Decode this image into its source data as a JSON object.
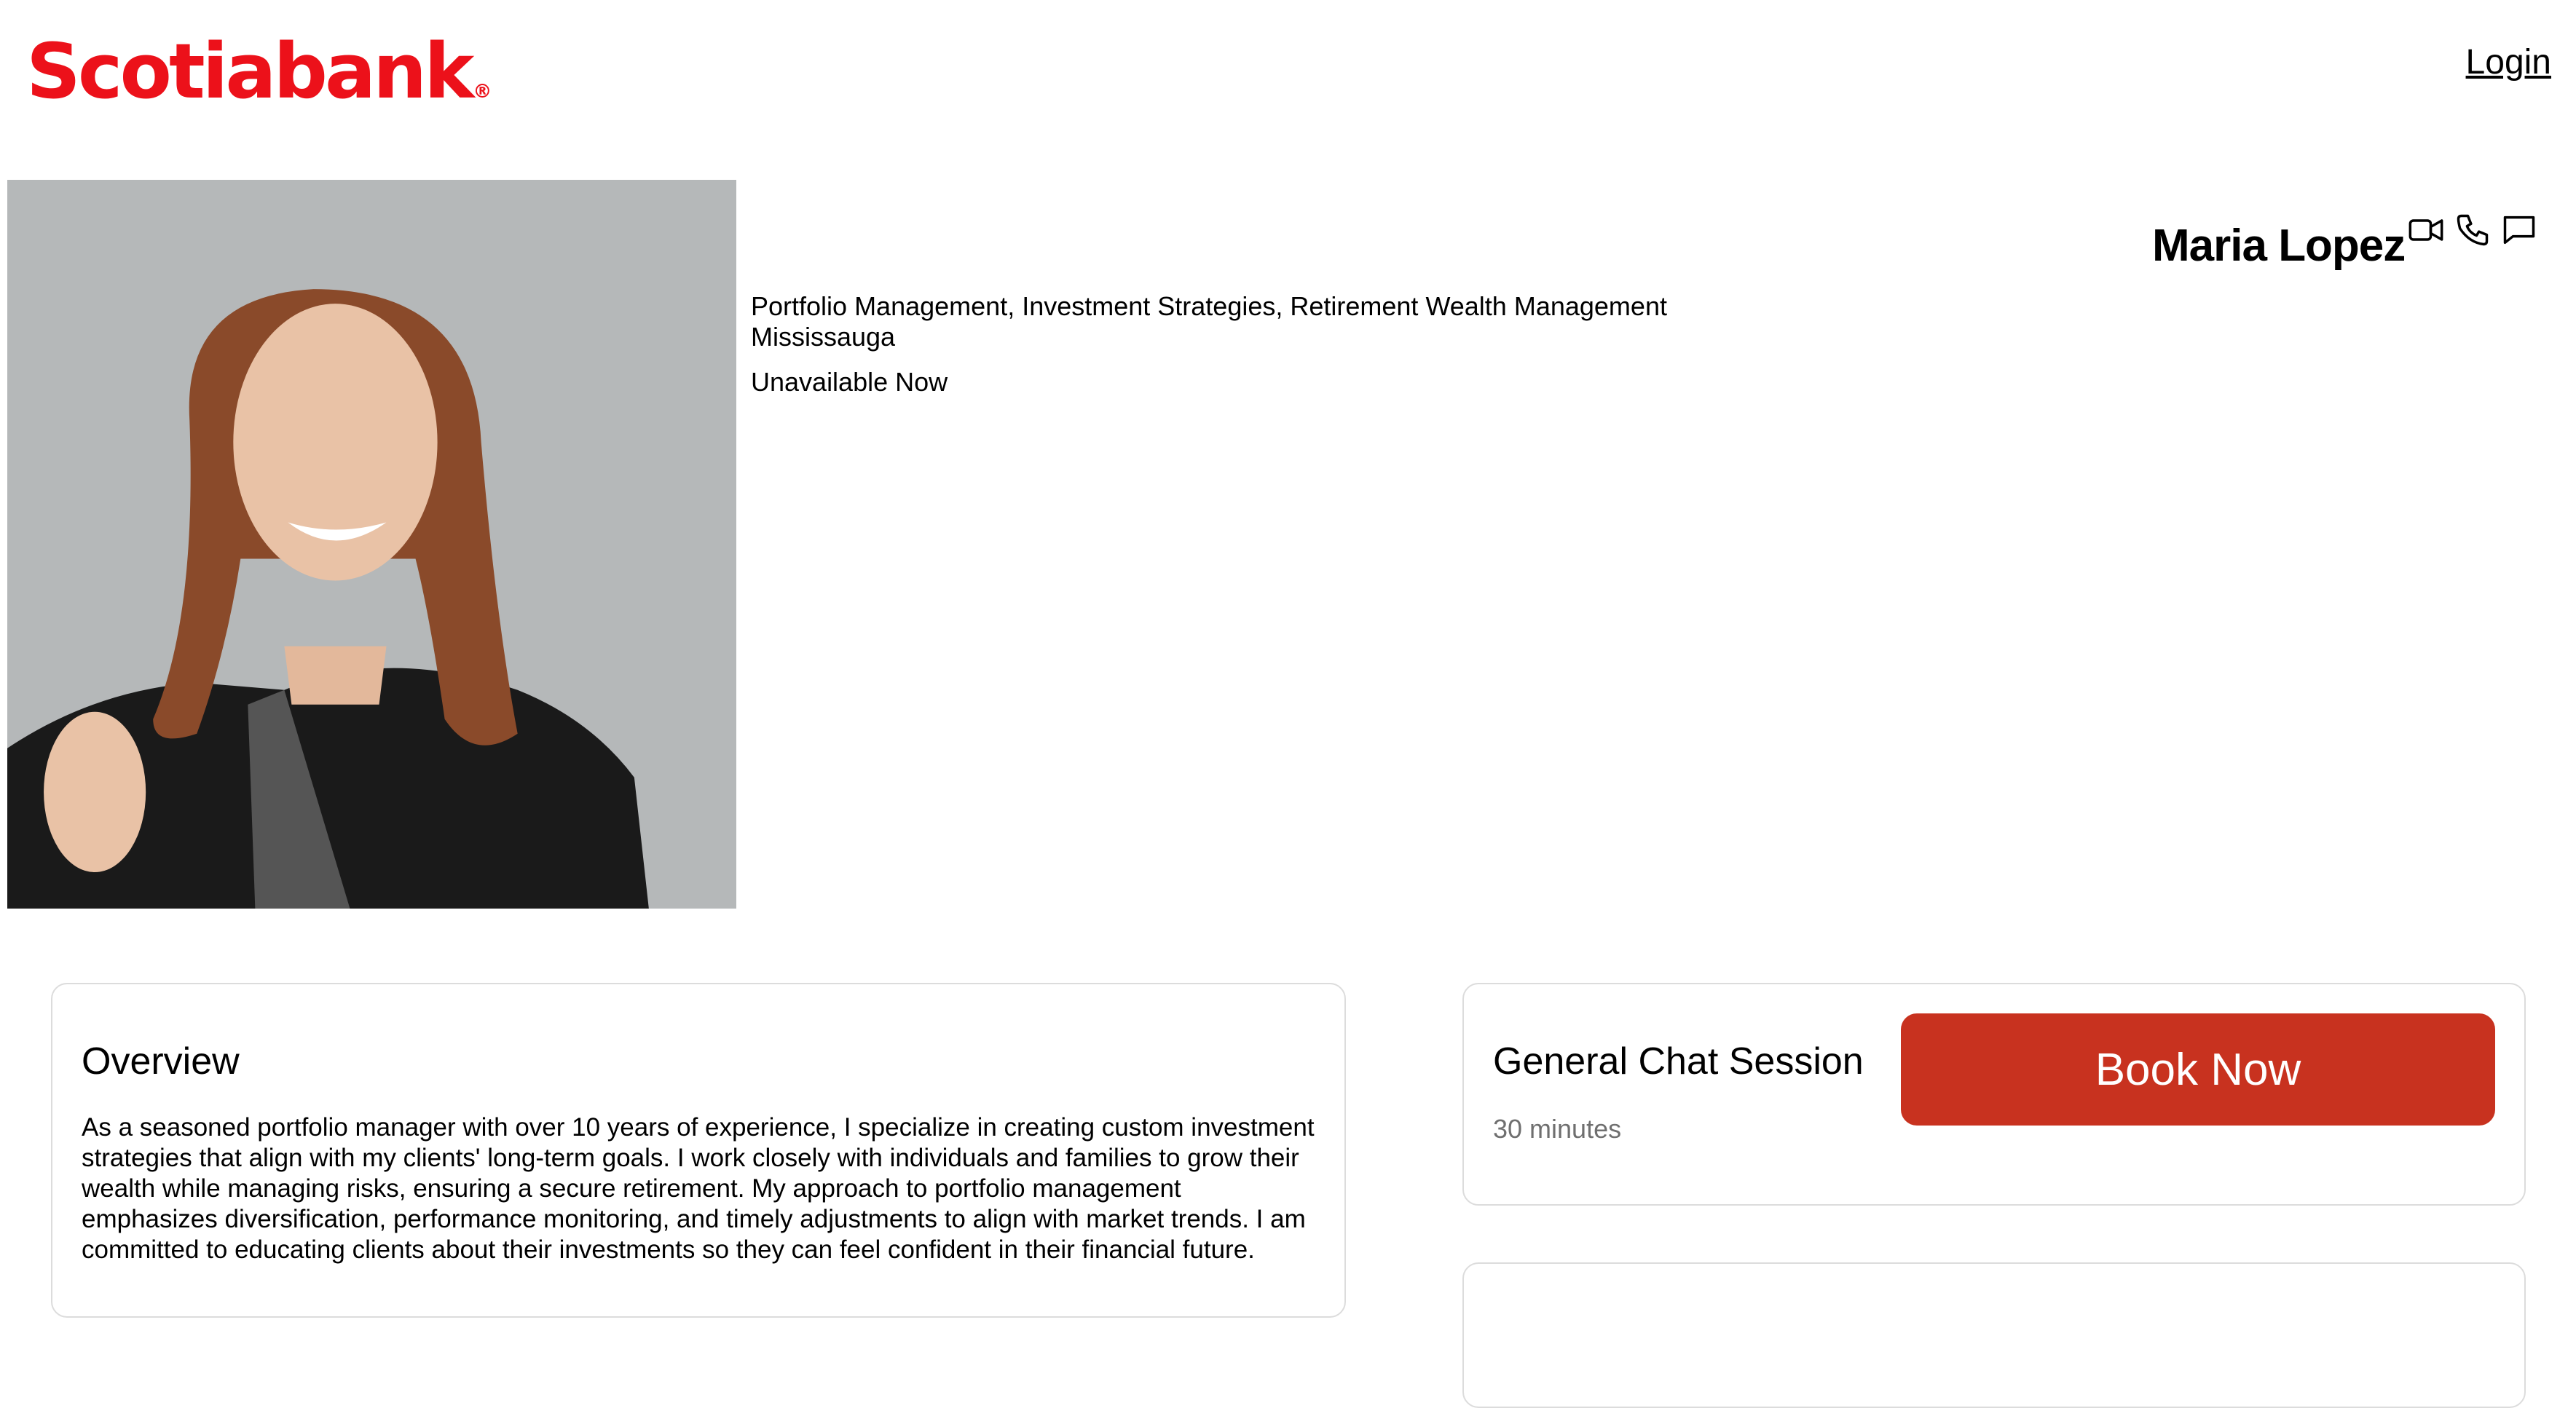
{
  "header": {
    "logo_text": "Scotiabank",
    "logo_mark": "®",
    "login_label": "Login"
  },
  "advisor": {
    "name": "Maria Lopez",
    "specialties": "Portfolio Management, Investment Strategies, Retirement Wealth Management",
    "location": "Mississauga",
    "availability": "Unavailable Now",
    "contact_icons": [
      "video-icon",
      "phone-icon",
      "chat-icon"
    ]
  },
  "overview": {
    "title": "Overview",
    "body": "As a seasoned portfolio manager with over 10 years of experience, I specialize in creating custom investment strategies that align with my clients' long-term goals. I work closely with individuals and families to grow their wealth while managing risks, ensuring a secure retirement. My approach to portfolio management emphasizes diversification, performance monitoring, and timely adjustments to align with market trends. I am committed to educating clients about their investments so they can feel confident in their financial future."
  },
  "session": {
    "title": "General Chat Session",
    "duration": "30 minutes",
    "book_label": "Book Now"
  },
  "colors": {
    "brand_red": "#ec111a",
    "button_red": "#c8321f",
    "card_border": "#dcdcdc",
    "muted_text": "#6f6f6f"
  }
}
